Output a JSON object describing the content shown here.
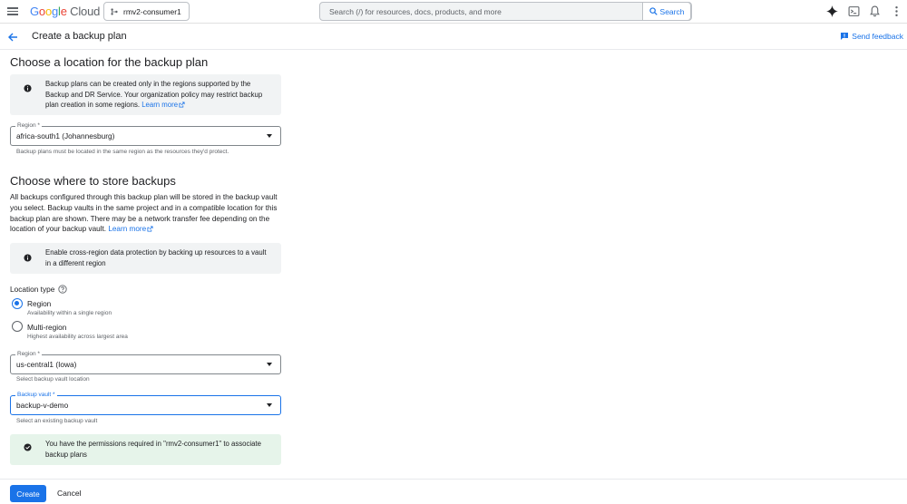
{
  "topbar": {
    "logo_google": [
      "G",
      "o",
      "o",
      "g",
      "l",
      "e"
    ],
    "logo_cloud": "Cloud",
    "project": "rmv2-consumer1",
    "search_placeholder": "Search (/) for resources, docs, products, and more",
    "search_button": "Search"
  },
  "header": {
    "title": "Create a backup plan",
    "feedback": "Send feedback"
  },
  "section1": {
    "heading": "Choose a location for the backup plan",
    "info_text": "Backup plans can be created only in the regions supported by the Backup and DR Service. Your organization policy may restrict backup plan creation in some regions.",
    "info_link": "Learn more",
    "region_label": "Region *",
    "region_value": "africa-south1 (Johannesburg)",
    "region_hint": "Backup plans must be located in the same region as the resources they'd protect."
  },
  "section2": {
    "heading": "Choose where to store backups",
    "description": "All backups configured through this backup plan will be stored in the backup vault you select. Backup vaults in the same project and in a compatible location for this backup plan are shown. There may be a network transfer fee depending on the location of your backup vault.",
    "description_link": "Learn more",
    "cross_region_info": "Enable cross-region data protection by backing up resources to a vault in a different region",
    "location_type_label": "Location type",
    "options": [
      {
        "label": "Region",
        "desc": "Availability within a single region",
        "checked": true
      },
      {
        "label": "Multi-region",
        "desc": "Highest availability across largest area",
        "checked": false
      }
    ],
    "region_label": "Region *",
    "region_value": "us-central1 (Iowa)",
    "region_hint": "Select backup vault location",
    "vault_label": "Backup vault *",
    "vault_value": "backup-v-demo",
    "vault_hint": "Select an existing backup vault",
    "permission_info": "You have the permissions required in \"rmv2-consumer1\" to associate backup plans"
  },
  "footer": {
    "create": "Create",
    "cancel": "Cancel"
  },
  "colors": {
    "accent": "#1a73e8",
    "info_bg": "#f1f3f4",
    "success_bg": "#e6f4ea"
  }
}
